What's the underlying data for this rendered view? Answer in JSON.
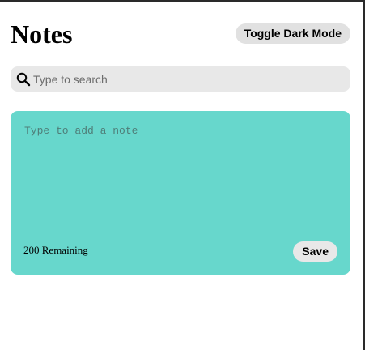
{
  "header": {
    "title": "Notes",
    "toggle_label": "Toggle Dark Mode"
  },
  "search": {
    "placeholder": "Type to search",
    "value": "",
    "icon": "search-icon"
  },
  "new_note": {
    "placeholder": "Type to add a note",
    "value": "",
    "remaining_label": "200 Remaining",
    "save_label": "Save",
    "background_color": "#67d7cc"
  }
}
